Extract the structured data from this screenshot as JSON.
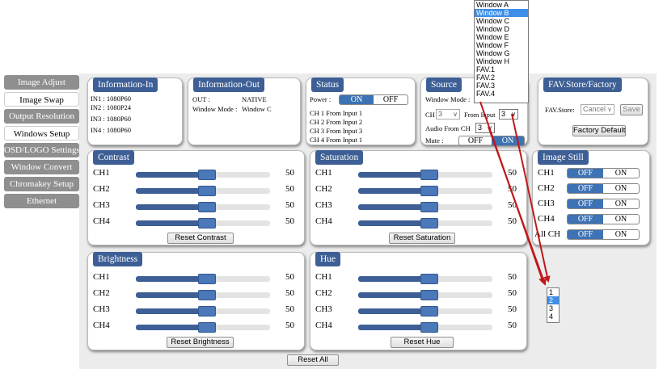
{
  "sidebar": {
    "items": [
      {
        "label": "Image Adjust",
        "style": "grey"
      },
      {
        "label": "Image Swap",
        "style": "white"
      },
      {
        "label": "Output Resolution",
        "style": "grey"
      },
      {
        "label": "Windows Setup",
        "style": "white"
      },
      {
        "label": "OSD/LOGO Settings",
        "style": "grey"
      },
      {
        "label": "Window Convert",
        "style": "grey"
      },
      {
        "label": "Chromakey Setup",
        "style": "grey"
      },
      {
        "label": "Ethernet",
        "style": "grey"
      }
    ]
  },
  "info_in": {
    "title": "Information-In",
    "lines": [
      "IN1 : 1080P60",
      "IN2 : 1080P24",
      "IN3 : 1080P60",
      "IN4 : 1080P60"
    ]
  },
  "info_out": {
    "title": "Information-Out",
    "out_label": "OUT :",
    "out_value": "NATIVE",
    "mode_label": "Window Mode :",
    "mode_value": "Window C"
  },
  "status": {
    "title": "Status",
    "power_label": "Power :",
    "on": "ON",
    "off": "OFF",
    "power_state": "ON",
    "lines": [
      "CH 1 From Input  1",
      "CH 2 From Input  2",
      "CH 3 From Input  3",
      "CH 4 From Input  1"
    ]
  },
  "source": {
    "title": "Source",
    "window_mode_label": "Window Mode :",
    "ch_label": "CH",
    "ch_value": "3",
    "from_input_label": "From Input",
    "from_input_value": "3",
    "audio_label": "Audio From CH",
    "audio_value": "3",
    "mute_label": "Mute :",
    "mute_off": "OFF",
    "mute_on": "ON"
  },
  "window_dropdown": {
    "options": [
      "Window A",
      "Window B",
      "Window C",
      "Window D",
      "Window E",
      "Window F",
      "Window G",
      "Window H",
      "FAV.1",
      "FAV.2",
      "FAV.3",
      "FAV.4"
    ],
    "highlighted": "Window B"
  },
  "input_dropdown": {
    "options": [
      "1",
      "2",
      "3",
      "4"
    ],
    "highlighted": "2"
  },
  "fav": {
    "title": "FAV.Store/Factory",
    "store_label": "FAV.Store:",
    "store_value": "Cancel",
    "save_label": "Save",
    "factory_label": "Factory Default"
  },
  "contrast": {
    "title": "Contrast",
    "channels": [
      {
        "label": "CH1",
        "value": "50"
      },
      {
        "label": "CH2",
        "value": "50"
      },
      {
        "label": "CH3",
        "value": "50"
      },
      {
        "label": "CH4",
        "value": "50"
      }
    ],
    "reset_label": "Reset Contrast"
  },
  "saturation": {
    "title": "Saturation",
    "channels": [
      {
        "label": "CH1",
        "value": "50"
      },
      {
        "label": "CH2",
        "value": "50"
      },
      {
        "label": "CH3",
        "value": "50"
      },
      {
        "label": "CH4",
        "value": "50"
      }
    ],
    "reset_label": "Reset Saturation"
  },
  "brightness": {
    "title": "Brightness",
    "channels": [
      {
        "label": "CH1",
        "value": "50"
      },
      {
        "label": "CH2",
        "value": "50"
      },
      {
        "label": "CH3",
        "value": "50"
      },
      {
        "label": "CH4",
        "value": "50"
      }
    ],
    "reset_label": "Reset Brightness"
  },
  "hue": {
    "title": "Hue",
    "channels": [
      {
        "label": "CH1",
        "value": "50"
      },
      {
        "label": "CH2",
        "value": "50"
      },
      {
        "label": "CH3",
        "value": "50"
      },
      {
        "label": "CH4",
        "value": "50"
      }
    ],
    "reset_label": "Reset Hue"
  },
  "image_still": {
    "title": "Image Still",
    "off": "OFF",
    "on": "ON",
    "rows": [
      "CH1",
      "CH2",
      "CH3",
      "CH4",
      "All CH"
    ],
    "state": "OFF"
  },
  "reset_all_label": "Reset All",
  "colors": {
    "header_blue": "#3d5f95",
    "toggle_blue": "#3d72b4",
    "highlight_blue": "#3d8ee8",
    "sidebar_grey": "#8f8f8f",
    "background_grey": "#ececec",
    "arrow_red": "#c0181a"
  }
}
